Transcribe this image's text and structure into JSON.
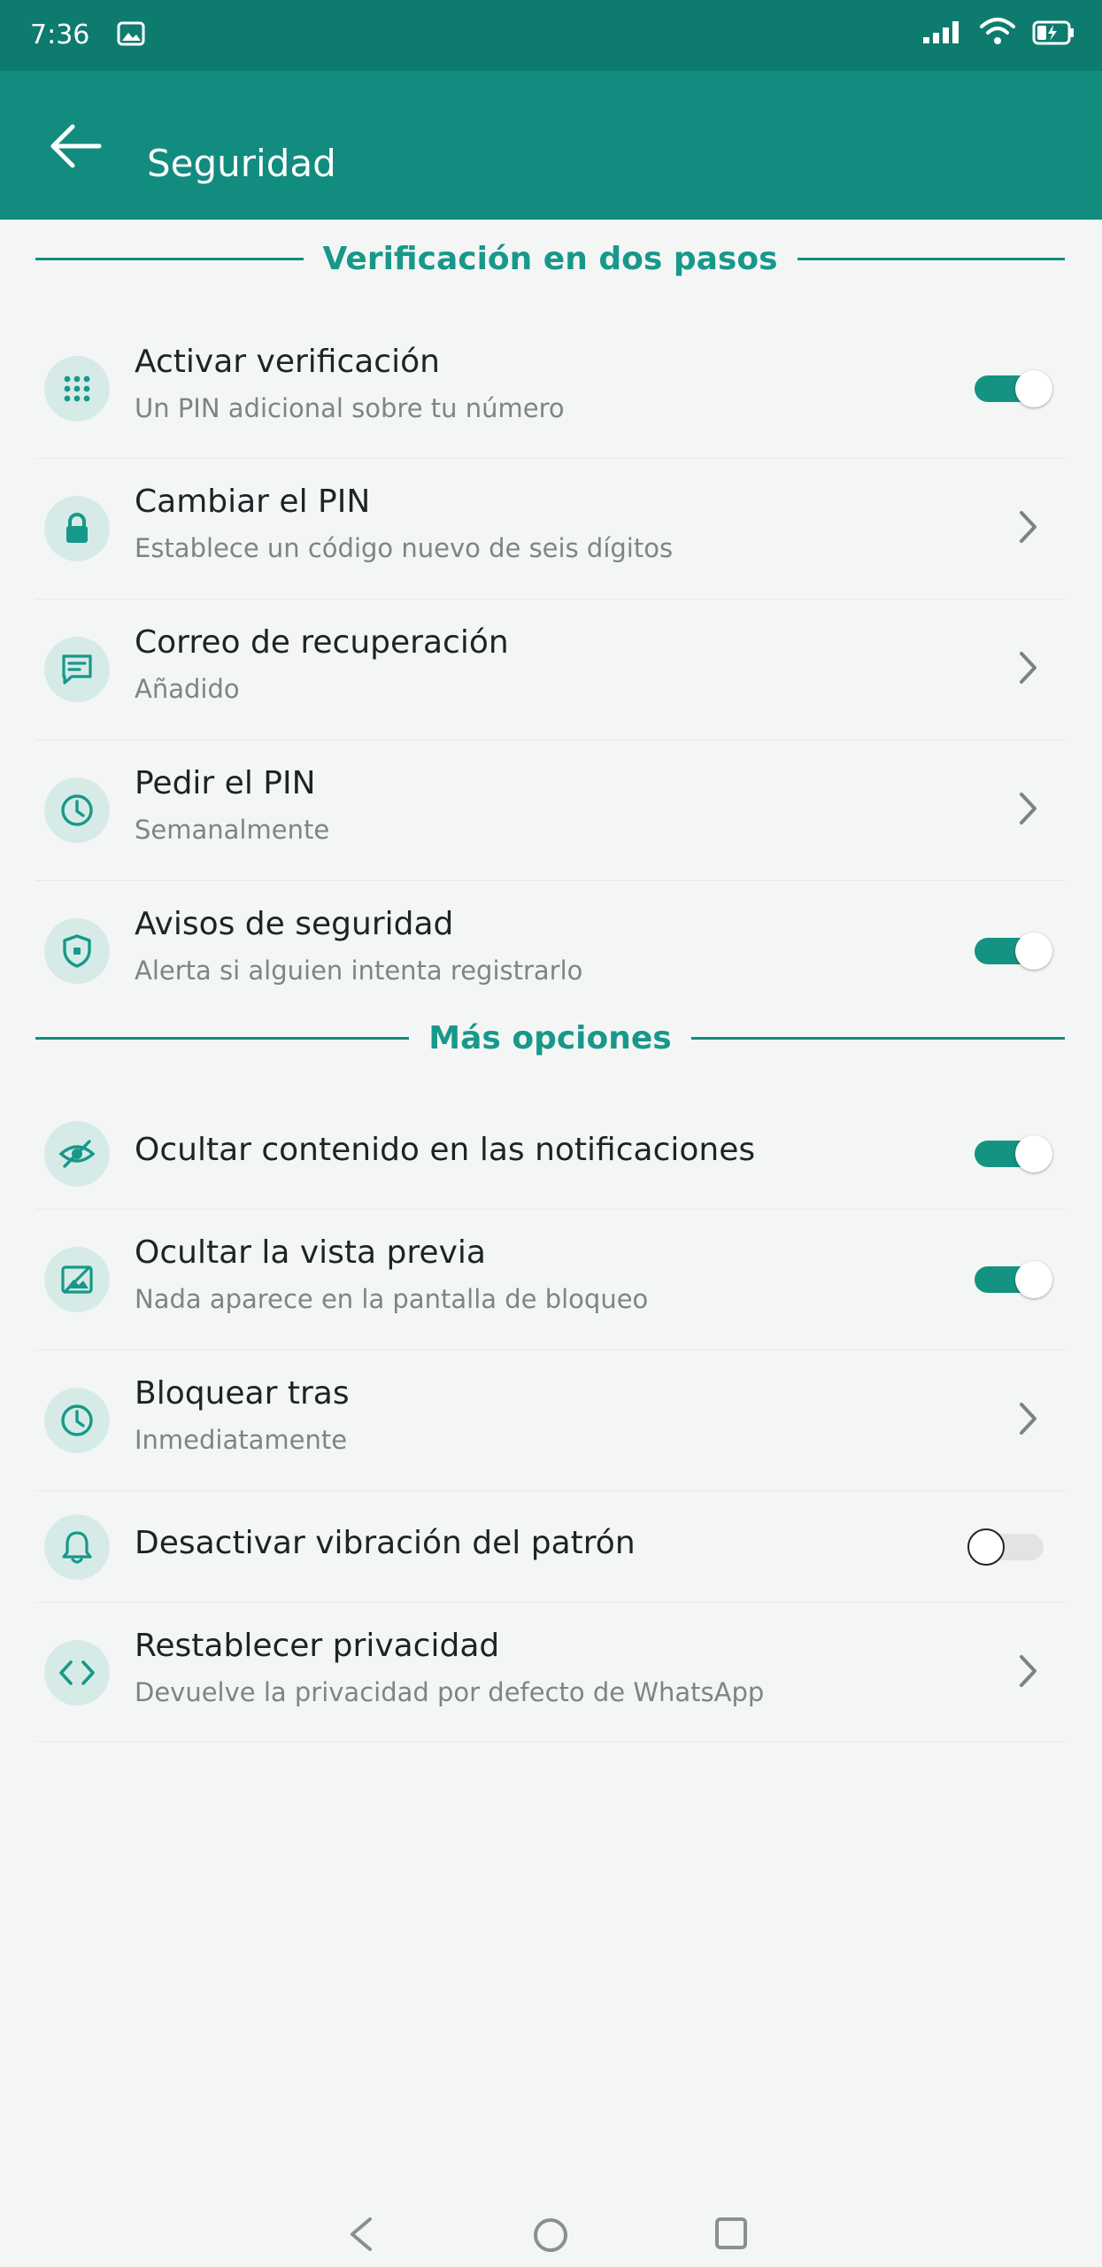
{
  "status_bar": {
    "time": "7:36"
  },
  "header": {
    "title": "Seguridad"
  },
  "sections": {
    "two_step": "Verificación en dos pasos",
    "more_options": "Más opciones"
  },
  "items": {
    "activate": {
      "title": "Activar verificación",
      "subtitle": "Un PIN adicional sobre tu número",
      "enabled": true
    },
    "change_pin": {
      "title": "Cambiar el PIN",
      "subtitle": "Establece un código nuevo de seis dígitos"
    },
    "recovery_email": {
      "title": "Correo de recuperación",
      "subtitle": "Añadido"
    },
    "ask_pin": {
      "title": "Pedir el PIN",
      "subtitle": "Semanalmente"
    },
    "security_alerts": {
      "title": "Avisos de seguridad",
      "subtitle": "Alerta si alguien intenta registrarlo",
      "enabled": true
    },
    "hide_content": {
      "title": "Ocultar contenido en las notificaciones",
      "enabled": true
    },
    "hide_preview": {
      "title": "Ocultar la vista previa",
      "subtitle": "Nada aparece en la pantalla de bloqueo",
      "enabled": true
    },
    "lock_after": {
      "title": "Bloquear tras",
      "subtitle": "Inmediatamente"
    },
    "disable_vibration": {
      "title": "Desactivar vibración del patrón",
      "enabled": false
    },
    "reset_privacy": {
      "title": "Restablecer privacidad",
      "subtitle": "Devuelve la privacidad por defecto de WhatsApp"
    }
  },
  "colors": {
    "status_bar": "#0e7b6f",
    "app_bar": "#128c7e",
    "accent": "#17988a",
    "icon_circle": "#d6ebe7",
    "background": "#f4f6f5"
  },
  "icons": {
    "activate": "dialpad-icon",
    "change_pin": "lock-icon",
    "recovery_email": "message-icon",
    "ask_pin": "clock-icon",
    "security_alerts": "shield-icon",
    "hide_content": "eye-off-icon",
    "hide_preview": "image-off-icon",
    "lock_after": "clock-icon",
    "disable_vibration": "bell-icon",
    "reset_privacy": "code-icon"
  }
}
